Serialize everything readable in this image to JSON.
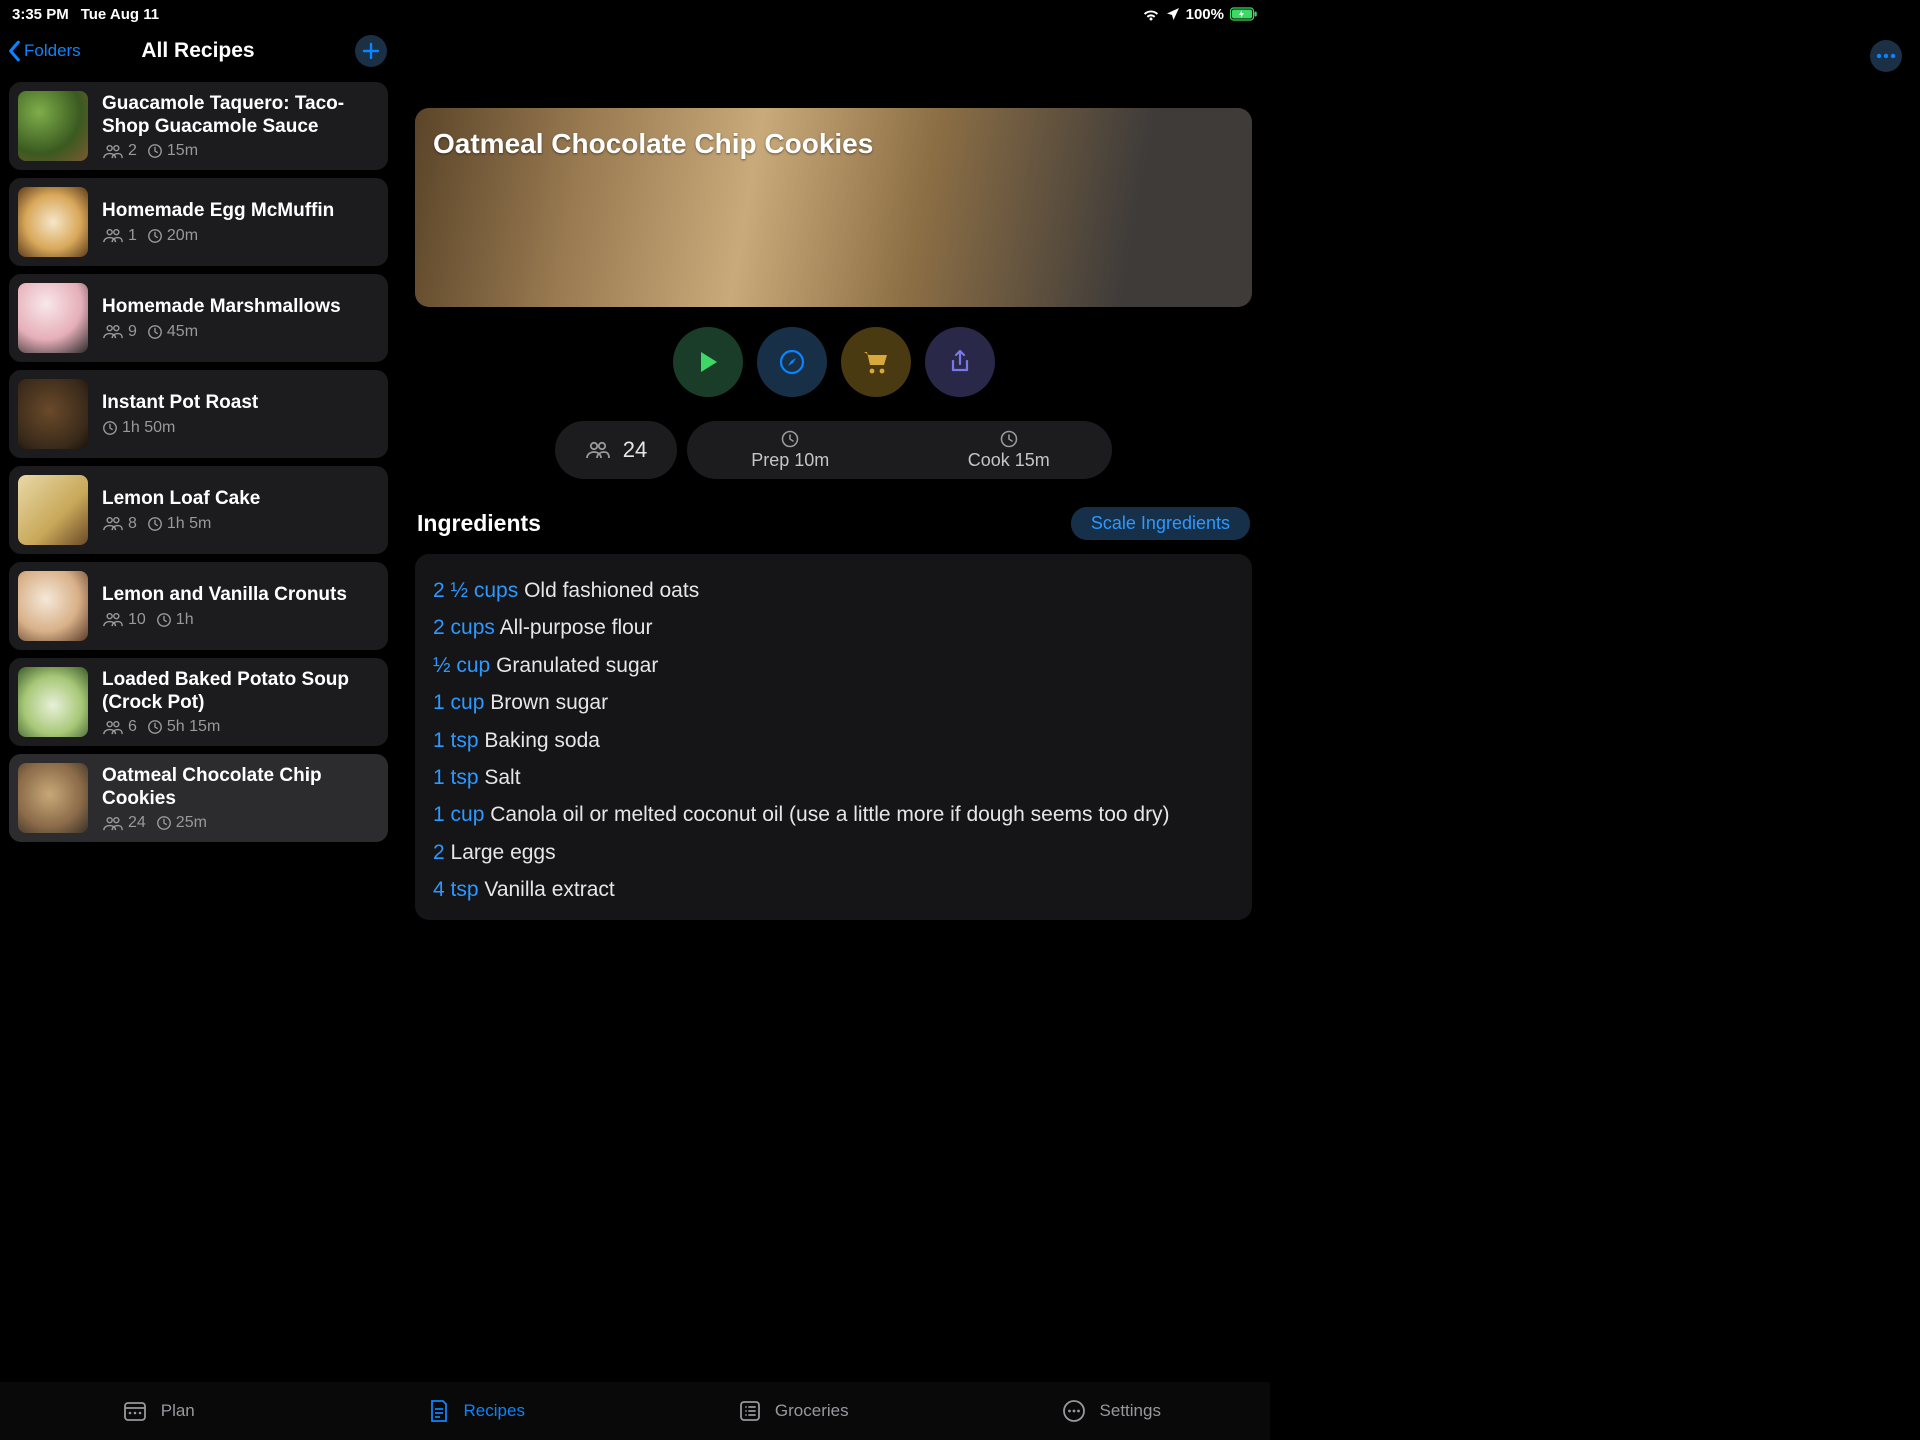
{
  "status": {
    "time": "3:35 PM",
    "date": "Tue Aug 11",
    "battery": "100%"
  },
  "nav": {
    "back": "Folders",
    "title": "All Recipes"
  },
  "more_button": "…",
  "sidebar": {
    "items": [
      {
        "title": "Guacamole Taquero: Taco-Shop Guacamole Sauce",
        "serv": "2",
        "time": "15m"
      },
      {
        "title": "Homemade Egg McMuffin",
        "serv": "1",
        "time": "20m"
      },
      {
        "title": "Homemade Marshmallows",
        "serv": "9",
        "time": "45m"
      },
      {
        "title": "Instant Pot Roast",
        "serv": "",
        "time": "1h 50m"
      },
      {
        "title": "Lemon Loaf Cake",
        "serv": "8",
        "time": "1h 5m"
      },
      {
        "title": "Lemon and Vanilla Cronuts",
        "serv": "10",
        "time": "1h"
      },
      {
        "title": "Loaded Baked Potato Soup (Crock Pot)",
        "serv": "6",
        "time": "5h 15m"
      },
      {
        "title": "Oatmeal Chocolate Chip Cookies",
        "serv": "24",
        "time": "25m"
      }
    ]
  },
  "detail": {
    "title": "Oatmeal Chocolate Chip Cookies",
    "servings": "24",
    "prep": "Prep 10m",
    "cook": "Cook 15m",
    "ing_heading": "Ingredients",
    "scale_label": "Scale Ingredients",
    "ingredients": [
      {
        "amt": "2 ½ cups",
        "name": "Old fashioned oats"
      },
      {
        "amt": "2 cups",
        "name": "All-purpose flour"
      },
      {
        "amt": "½ cup",
        "name": "Granulated sugar"
      },
      {
        "amt": "1 cup",
        "name": "Brown sugar"
      },
      {
        "amt": "1 tsp",
        "name": "Baking soda"
      },
      {
        "amt": "1 tsp",
        "name": "Salt"
      },
      {
        "amt": "1 cup",
        "name": "Canola oil or melted coconut oil (use a little more if dough seems too dry)"
      },
      {
        "amt": "2",
        "name": "Large eggs"
      },
      {
        "amt": "4 tsp",
        "name": "Vanilla extract"
      }
    ]
  },
  "tabs": {
    "plan": "Plan",
    "recipes": "Recipes",
    "groceries": "Groceries",
    "settings": "Settings"
  }
}
